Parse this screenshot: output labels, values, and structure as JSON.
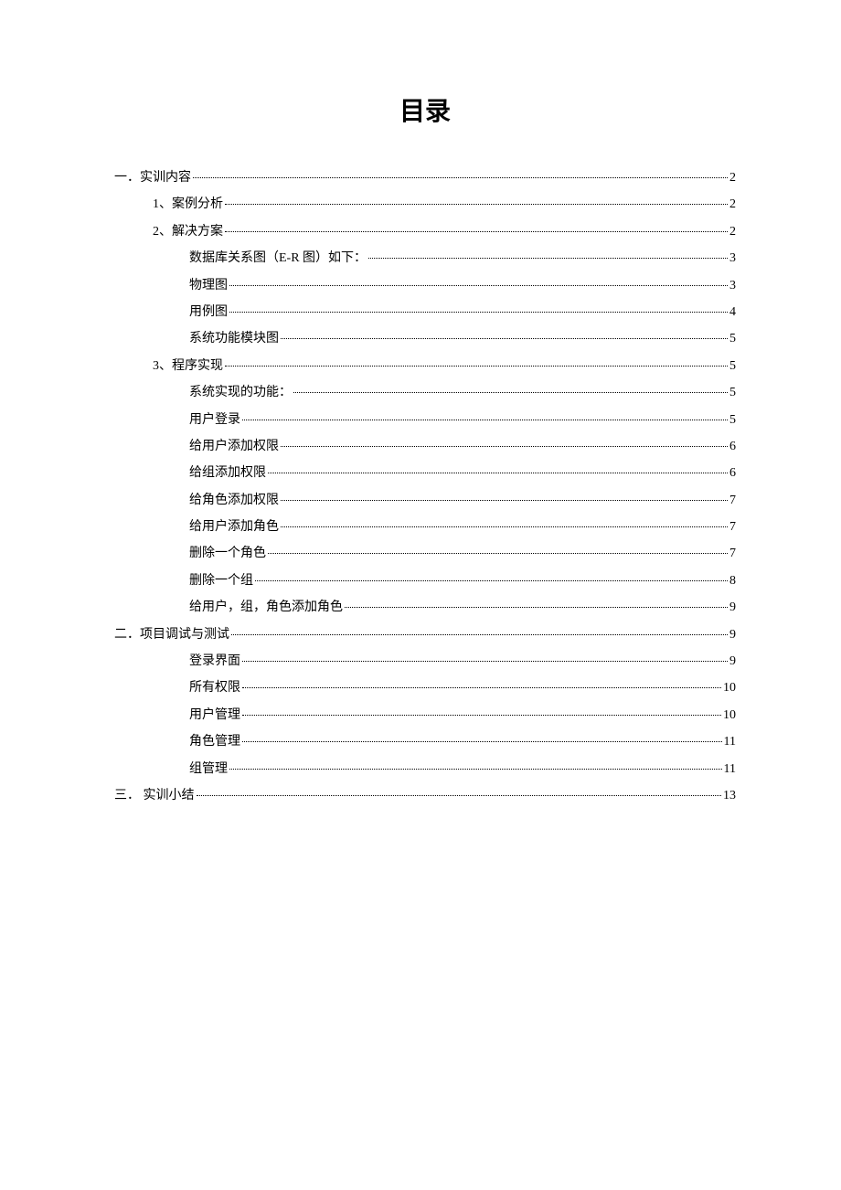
{
  "title": "目录",
  "entries": [
    {
      "level": 1,
      "label": "一．实训内容",
      "page": "2"
    },
    {
      "level": 2,
      "label": "1、案例分析",
      "page": "2"
    },
    {
      "level": 2,
      "label": "2、解决方案",
      "page": "2"
    },
    {
      "level": 3,
      "label": "数据库关系图（E-R 图）如下：",
      "page": "3"
    },
    {
      "level": 3,
      "label": "物理图",
      "page": "3"
    },
    {
      "level": 3,
      "label": "用例图",
      "page": "4"
    },
    {
      "level": 3,
      "label": "系统功能模块图",
      "page": "5"
    },
    {
      "level": 2,
      "label": "3、程序实现",
      "page": "5"
    },
    {
      "level": 3,
      "label": "系统实现的功能：",
      "page": "5"
    },
    {
      "level": 3,
      "label": "用户登录",
      "page": "5"
    },
    {
      "level": 3,
      "label": "给用户添加权限",
      "page": "6"
    },
    {
      "level": 3,
      "label": "给组添加权限",
      "page": "6"
    },
    {
      "level": 3,
      "label": "给角色添加权限",
      "page": "7"
    },
    {
      "level": 3,
      "label": "给用户添加角色",
      "page": "7"
    },
    {
      "level": 3,
      "label": "删除一个角色",
      "page": "7"
    },
    {
      "level": 3,
      "label": "删除一个组",
      "page": "8"
    },
    {
      "level": 3,
      "label": "给用户，组，角色添加角色",
      "page": "9"
    },
    {
      "level": 1,
      "label": "二．项目调试与测试",
      "page": "9"
    },
    {
      "level": 3,
      "label": "登录界面",
      "page": "9"
    },
    {
      "level": 3,
      "label": "所有权限",
      "page": "10"
    },
    {
      "level": 3,
      "label": "用户管理",
      "page": "10"
    },
    {
      "level": 3,
      "label": "角色管理",
      "page": "11"
    },
    {
      "level": 3,
      "label": "组管理",
      "page": "11"
    },
    {
      "level": 1,
      "label": "三． 实训小结",
      "page": "13"
    }
  ]
}
